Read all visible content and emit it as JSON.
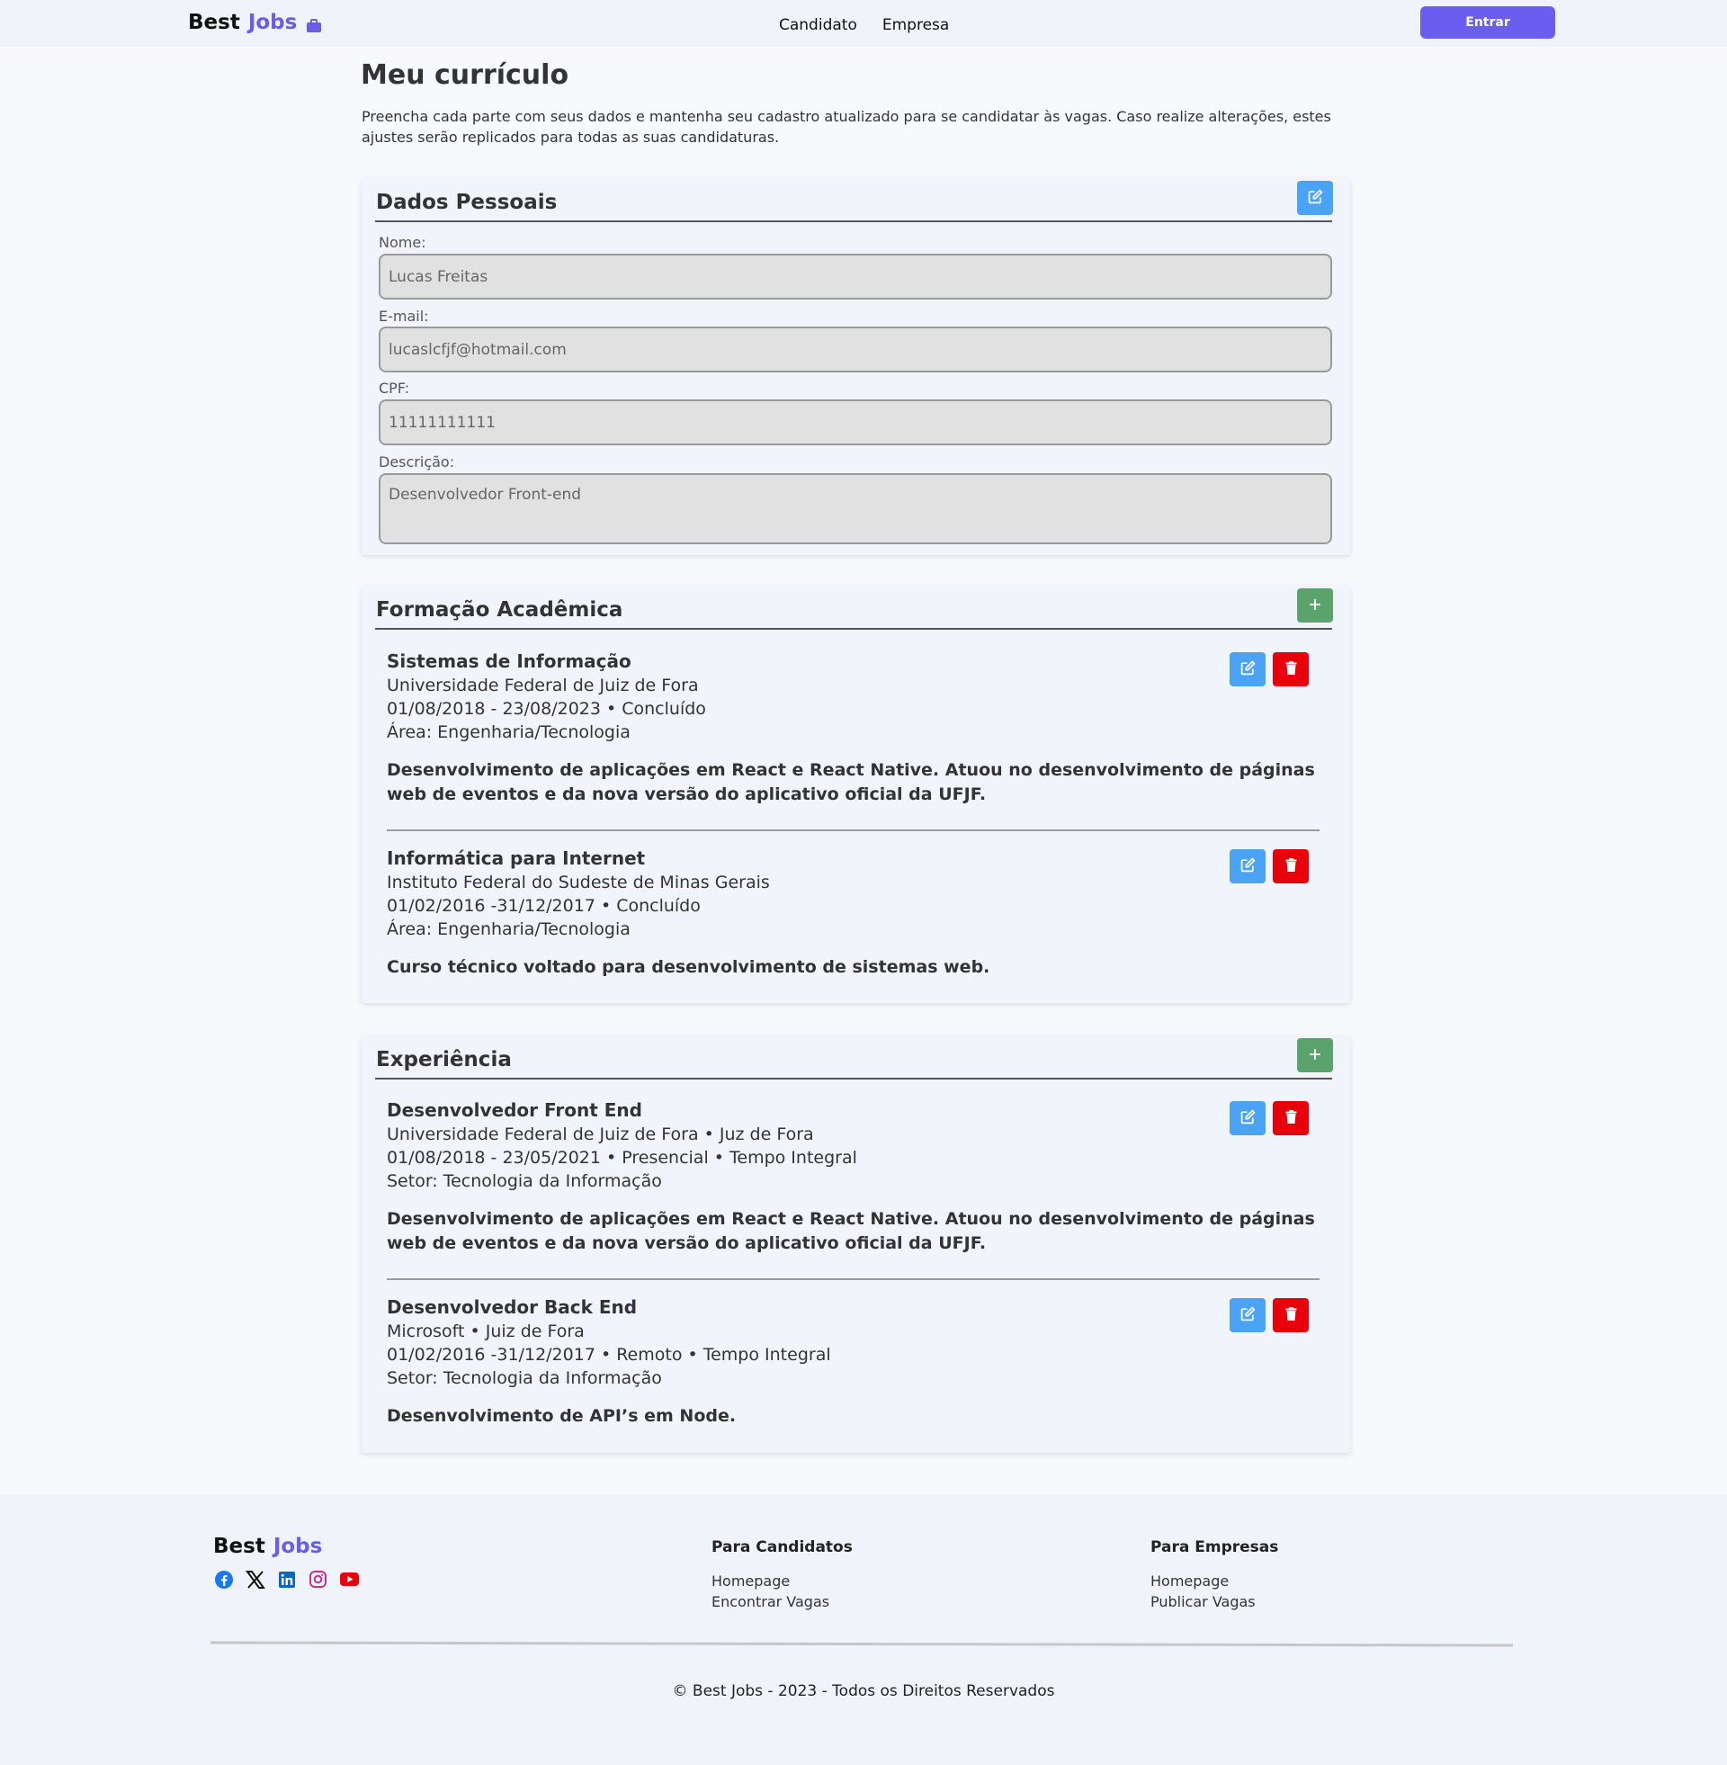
{
  "header": {
    "brand_best": "Best",
    "brand_jobs": "Jobs",
    "nav": [
      "Candidato",
      "Empresa"
    ],
    "login_label": "Entrar"
  },
  "main": {
    "title": "Meu currículo",
    "intro": "Preencha cada parte com seus dados e mantenha seu cadastro atualizado para se candidatar às vagas. Caso realize alterações, estes ajustes serão replicados para todas as suas candidaturas."
  },
  "personal": {
    "title": "Dados Pessoais",
    "fields": {
      "name_label": "Nome:",
      "name_value": "Lucas Freitas",
      "email_label": "E-mail:",
      "email_value": "lucaslcfjf@hotmail.com",
      "cpf_label": "CPF:",
      "cpf_value": "11111111111",
      "desc_label": "Descrição:",
      "desc_value": "Desenvolvedor Front-end"
    }
  },
  "education": {
    "title": "Formação Acadêmica",
    "items": [
      {
        "title": "Sistemas de Informação",
        "institution": "Universidade Federal de Juiz de Fora",
        "period": "01/08/2018 - 23/08/2023 • Concluído",
        "area": "Área: Engenharia/Tecnologia",
        "description": "Desenvolvimento de aplicações em React e React Native. Atuou no desenvolvimento de páginas web de eventos e da nova versão do aplicativo oficial da UFJF."
      },
      {
        "title": "Informática para Internet",
        "institution": "Instituto Federal do Sudeste de Minas Gerais",
        "period": "01/02/2016 -31/12/2017 • Concluído",
        "area": "Área: Engenharia/Tecnologia",
        "description": "Curso técnico voltado para desenvolvimento de sistemas web."
      }
    ]
  },
  "experience": {
    "title": "Experiência",
    "items": [
      {
        "title": "Desenvolvedor Front End",
        "company": "Universidade Federal de Juiz de Fora • Juz de Fora",
        "period": "01/08/2018 - 23/05/2021 • Presencial • Tempo Integral",
        "sector": "Setor: Tecnologia da Informação",
        "description": "Desenvolvimento de aplicações em React e React Native. Atuou no desenvolvimento de páginas web de eventos e da nova versão do aplicativo oficial da UFJF."
      },
      {
        "title": "Desenvolvedor Back End",
        "company": "Microsoft • Juiz de Fora",
        "period": "01/02/2016 -31/12/2017 • Remoto • Tempo Integral",
        "sector": "Setor: Tecnologia da Informação",
        "description": "Desenvolvimento de API’s em Node."
      }
    ]
  },
  "footer": {
    "brand_best": "Best",
    "brand_jobs": "Jobs",
    "socials": [
      "facebook-icon",
      "x-icon",
      "linkedin-icon",
      "instagram-icon",
      "youtube-icon"
    ],
    "candidates_title": "Para Candidatos",
    "candidates_links": [
      "Homepage",
      "Encontrar Vagas"
    ],
    "companies_title": "Para Empresas",
    "companies_links": [
      "Homepage",
      "Publicar Vagas"
    ],
    "copyright": "© Best Jobs - 2023 - Todos os Direitos Reservados"
  },
  "colors": {
    "accent": "#6a5df0",
    "edit": "#4aa3f5",
    "add": "#5aa36c",
    "delete": "#e8000b"
  }
}
